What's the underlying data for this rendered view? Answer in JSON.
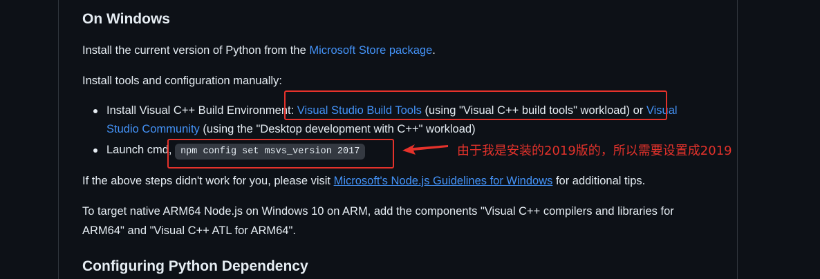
{
  "section1": {
    "heading": "On Windows",
    "para1_prefix": "Install the current version of Python from the ",
    "para1_link": "Microsoft Store package",
    "para1_suffix": ".",
    "para2": "Install tools and configuration manually:",
    "bullets": [
      {
        "prefix": "Install Visual C++ Build Environment: ",
        "link1": "Visual Studio Build Tools",
        "middle": " (using \"Visual C++ build tools\" workload) or ",
        "link2a": "Visual",
        "link2b": "Studio Community",
        "suffix": " (using the \"Desktop development with C++\" workload)"
      },
      {
        "prefix": "Launch cmd, ",
        "code": "npm config set msvs_version 2017"
      }
    ],
    "para3_prefix": "If the above steps didn't work for you, please visit ",
    "para3_link": "Microsoft's Node.js Guidelines for Windows",
    "para3_suffix": " for additional tips.",
    "para4_line1": "To target native ARM64 Node.js on Windows 10 on ARM, add the components \"Visual C++ compilers and libraries for",
    "para4_line2": "ARM64\" and \"Visual C++ ATL for ARM64\"."
  },
  "section2": {
    "heading": "Configuring Python Dependency"
  },
  "annotation": {
    "note": "由于我是安装的2019版的，所以需要设置成2019",
    "color": "#e5322b"
  },
  "colors": {
    "background": "#0d1117",
    "text": "#e6edf3",
    "link": "#4493f8",
    "code_bg": "#343941"
  }
}
